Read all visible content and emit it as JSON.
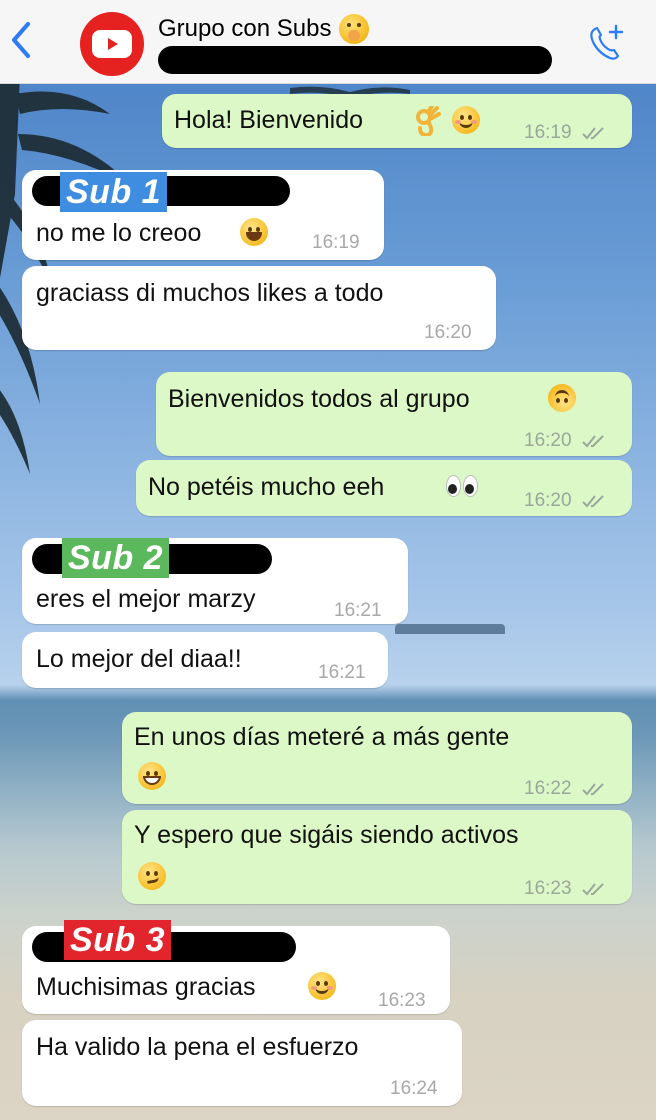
{
  "header": {
    "title": "Grupo con Subs",
    "title_emoji": "shushing-face-icon",
    "back_icon": "chevron-left-icon",
    "avatar_icon": "youtube-logo-icon",
    "call_icon": "add-call-icon"
  },
  "colors": {
    "accent": "#2b7cf6",
    "outgoing_bubble": "#dcf8c6",
    "incoming_bubble": "#ffffff",
    "header_bg": "#f6f6f6",
    "sub1": "#3f8de0",
    "sub2": "#5cb85c",
    "sub3": "#e2242c"
  },
  "messages": [
    {
      "dir": "out",
      "text": "Hola! Bienvenido",
      "emoji": [
        "ok-hand-icon",
        "smiling-face-icon"
      ],
      "time": "16:19"
    },
    {
      "dir": "in",
      "sender_tag": "Sub 1",
      "text": "no me lo creoo",
      "emoji": [
        "laughing-face-icon"
      ],
      "time": "16:19"
    },
    {
      "dir": "in",
      "text": "graciass di muchos likes a todo",
      "time": "16:20"
    },
    {
      "dir": "out",
      "text": "Bienvenidos todos al grupo",
      "emoji": [
        "upside-down-face-icon"
      ],
      "time": "16:20"
    },
    {
      "dir": "out",
      "text": "No petéis mucho eeh",
      "emoji": [
        "eyes-icon"
      ],
      "time": "16:20"
    },
    {
      "dir": "in",
      "sender_tag": "Sub 2",
      "text": "eres el mejor marzy",
      "time": "16:21"
    },
    {
      "dir": "in",
      "text": "Lo mejor del diaa!!",
      "time": "16:21"
    },
    {
      "dir": "out",
      "text": "En unos días meteré a más gente",
      "emoji": [
        "grinning-face-icon"
      ],
      "time": "16:22"
    },
    {
      "dir": "out",
      "text": "Y espero que sigáis siendo activos",
      "emoji": [
        "smirking-face-icon"
      ],
      "time": "16:23"
    },
    {
      "dir": "in",
      "sender_tag": "Sub 3",
      "text": "Muchisimas gracias",
      "emoji": [
        "blushing-face-icon"
      ],
      "time": "16:23"
    },
    {
      "dir": "in",
      "text": "Ha valido la pena el esfuerzo",
      "time": "16:24"
    }
  ]
}
